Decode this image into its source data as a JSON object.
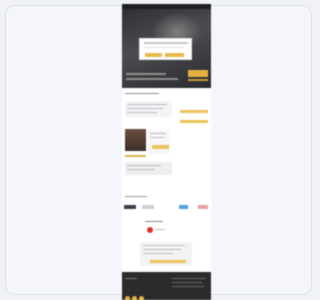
{
  "frame": {
    "background": "#f4f6fb"
  },
  "thumbnail": {
    "description_hidden": "",
    "palette": {
      "accent": "#e5b23f",
      "hero": "#2b2d33",
      "footer": "#2b2b2b",
      "badge": "#d8322a"
    }
  }
}
